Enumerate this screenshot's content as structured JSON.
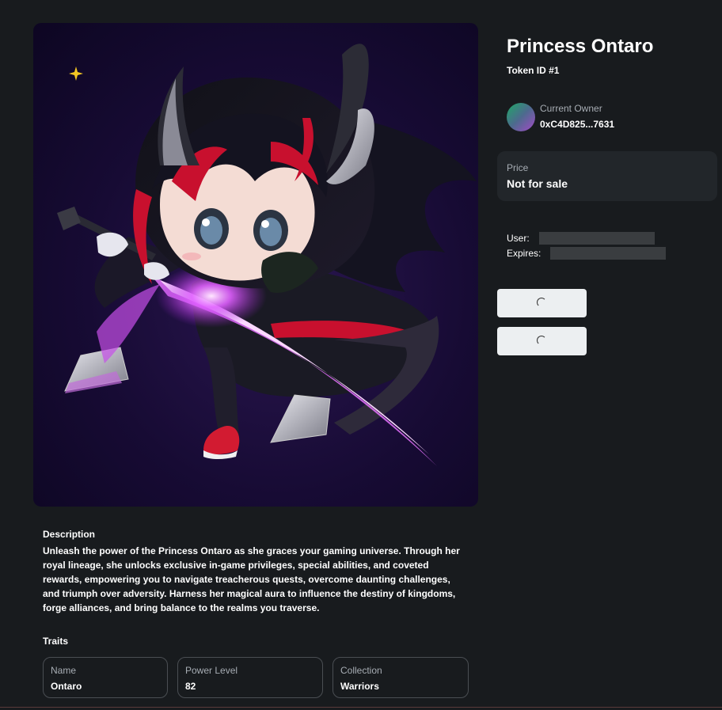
{
  "nft": {
    "title": "Princess Ontaro",
    "token_id": "Token ID #1",
    "image_alt": "Princess Ontaro artwork"
  },
  "owner": {
    "label": "Current Owner",
    "address": "0xC4D825...7631"
  },
  "price": {
    "label": "Price",
    "value": "Not for sale"
  },
  "rental": {
    "user_label": "User:",
    "expires_label": "Expires:"
  },
  "description": {
    "heading": "Description",
    "text": "Unleash the power of the Princess Ontaro as she graces your gaming universe. Through her royal lineage, she unlocks exclusive in-game privileges, special abilities, and coveted rewards, empowering you to navigate treacherous quests, overcome daunting challenges, and triumph over adversity. Harness her magical aura to influence the destiny of kingdoms, forge alliances, and bring balance to the realms you traverse."
  },
  "traits": {
    "heading": "Traits",
    "items": [
      {
        "label": "Name",
        "value": "Ontaro"
      },
      {
        "label": "Power Level",
        "value": "82"
      },
      {
        "label": "Collection",
        "value": "Warriors"
      }
    ]
  },
  "colors": {
    "background": "#181b1e",
    "card": "#22262a",
    "muted_text": "#a7adb4",
    "button": "#eceff1",
    "artwork_bg": "#170b34",
    "accent_magenta": "#d04cf0",
    "accent_red": "#c8102e"
  },
  "icons": {
    "button_state": "loading-spinner-icon",
    "sparkle": "sparkle-icon"
  }
}
